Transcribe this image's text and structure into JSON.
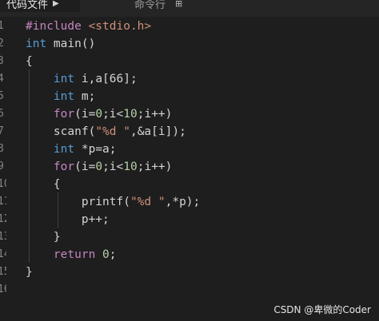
{
  "tabs": [
    {
      "label": "代码文件",
      "active": true
    },
    {
      "label": "命令行",
      "active": false
    }
  ],
  "editor": {
    "line_numbers": [
      "1",
      "2",
      "3",
      "4",
      "5",
      "6",
      "7",
      "8",
      "9",
      "10",
      "11",
      "12",
      "13",
      "14",
      "15",
      "16"
    ],
    "lines": [
      [
        {
          "t": "#include ",
          "c": "pp"
        },
        {
          "t": "<stdio.h>",
          "c": "inc"
        }
      ],
      [
        {
          "t": "int",
          "c": "ty"
        },
        {
          "t": " main()",
          "c": "txt"
        }
      ],
      [
        {
          "t": "{",
          "c": "txt"
        }
      ],
      [
        {
          "t": "    ",
          "c": "txt"
        },
        {
          "t": "int",
          "c": "ty"
        },
        {
          "t": " i,a[66];",
          "c": "txt"
        }
      ],
      [
        {
          "t": "    ",
          "c": "txt"
        },
        {
          "t": "int",
          "c": "ty"
        },
        {
          "t": " m;",
          "c": "txt"
        }
      ],
      [
        {
          "t": "    ",
          "c": "txt"
        },
        {
          "t": "for",
          "c": "pp"
        },
        {
          "t": "(i=",
          "c": "txt"
        },
        {
          "t": "0",
          "c": "num"
        },
        {
          "t": ";i<",
          "c": "txt"
        },
        {
          "t": "10",
          "c": "num"
        },
        {
          "t": ";i++)",
          "c": "txt"
        }
      ],
      [
        {
          "t": "    ",
          "c": "txt"
        },
        {
          "t": "scanf(",
          "c": "txt"
        },
        {
          "t": "\"%d \"",
          "c": "str"
        },
        {
          "t": ",&a[i]);",
          "c": "txt"
        }
      ],
      [
        {
          "t": "    ",
          "c": "txt"
        },
        {
          "t": "int",
          "c": "ty"
        },
        {
          "t": " *p=a;",
          "c": "txt"
        }
      ],
      [
        {
          "t": "    ",
          "c": "txt"
        },
        {
          "t": "for",
          "c": "pp"
        },
        {
          "t": "(i=",
          "c": "txt"
        },
        {
          "t": "0",
          "c": "num"
        },
        {
          "t": ";i<",
          "c": "txt"
        },
        {
          "t": "10",
          "c": "num"
        },
        {
          "t": ";i++)",
          "c": "txt"
        }
      ],
      [
        {
          "t": "    ",
          "c": "txt"
        },
        {
          "t": "{",
          "c": "txt"
        }
      ],
      [
        {
          "t": "        ",
          "c": "txt"
        },
        {
          "t": "printf(",
          "c": "txt"
        },
        {
          "t": "\"%d \"",
          "c": "str"
        },
        {
          "t": ",*p);",
          "c": "txt"
        }
      ],
      [
        {
          "t": "        ",
          "c": "txt"
        },
        {
          "t": "p++;",
          "c": "txt"
        }
      ],
      [
        {
          "t": "    ",
          "c": "txt"
        },
        {
          "t": "}",
          "c": "txt"
        }
      ],
      [
        {
          "t": "    ",
          "c": "txt"
        },
        {
          "t": "return",
          "c": "pp"
        },
        {
          "t": " ",
          "c": "txt"
        },
        {
          "t": "0",
          "c": "num"
        },
        {
          "t": ";",
          "c": "txt"
        }
      ],
      [
        {
          "t": "}",
          "c": "txt"
        }
      ],
      []
    ]
  },
  "watermark": "CSDN @卑微的Coder",
  "colors": {
    "background": "#1e1e1e",
    "keyword": "#569cd6",
    "control": "#c586c0",
    "string": "#ce9178",
    "number": "#b5cea8",
    "text": "#d4d4d4"
  }
}
